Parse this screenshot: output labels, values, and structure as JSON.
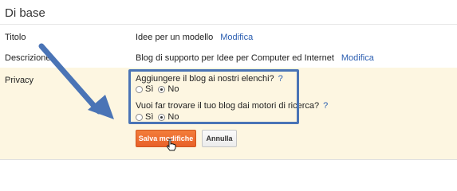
{
  "section": {
    "title": "Di base"
  },
  "rows": {
    "title": {
      "label": "Titolo",
      "value": "Idee per un modello",
      "action": "Modifica"
    },
    "description": {
      "label": "Descrizione",
      "value": "Blog di supporto per Idee per Computer ed Internet",
      "action": "Modifica"
    },
    "privacy": {
      "label": "Privacy",
      "q1": {
        "text": "Aggiungere il blog ai nostri elenchi?",
        "help": "?",
        "options": [
          "Sì",
          "No"
        ],
        "selected": "No"
      },
      "q2": {
        "text": "Vuoi far trovare il tuo blog dai motori di ricerca?",
        "help": "?",
        "options": [
          "Sì",
          "No"
        ],
        "selected": "No"
      }
    }
  },
  "buttons": {
    "save": "Salva modifiche",
    "cancel": "Annulla"
  },
  "colors": {
    "accent_orange": "#e8612a",
    "link_blue": "#2a5db0",
    "annotation_blue": "#4a74b6",
    "privacy_background": "#fdf6e1"
  },
  "icons": {
    "annotation_arrow": "arrow-icon",
    "mouse_pointer": "hand-cursor-icon"
  }
}
